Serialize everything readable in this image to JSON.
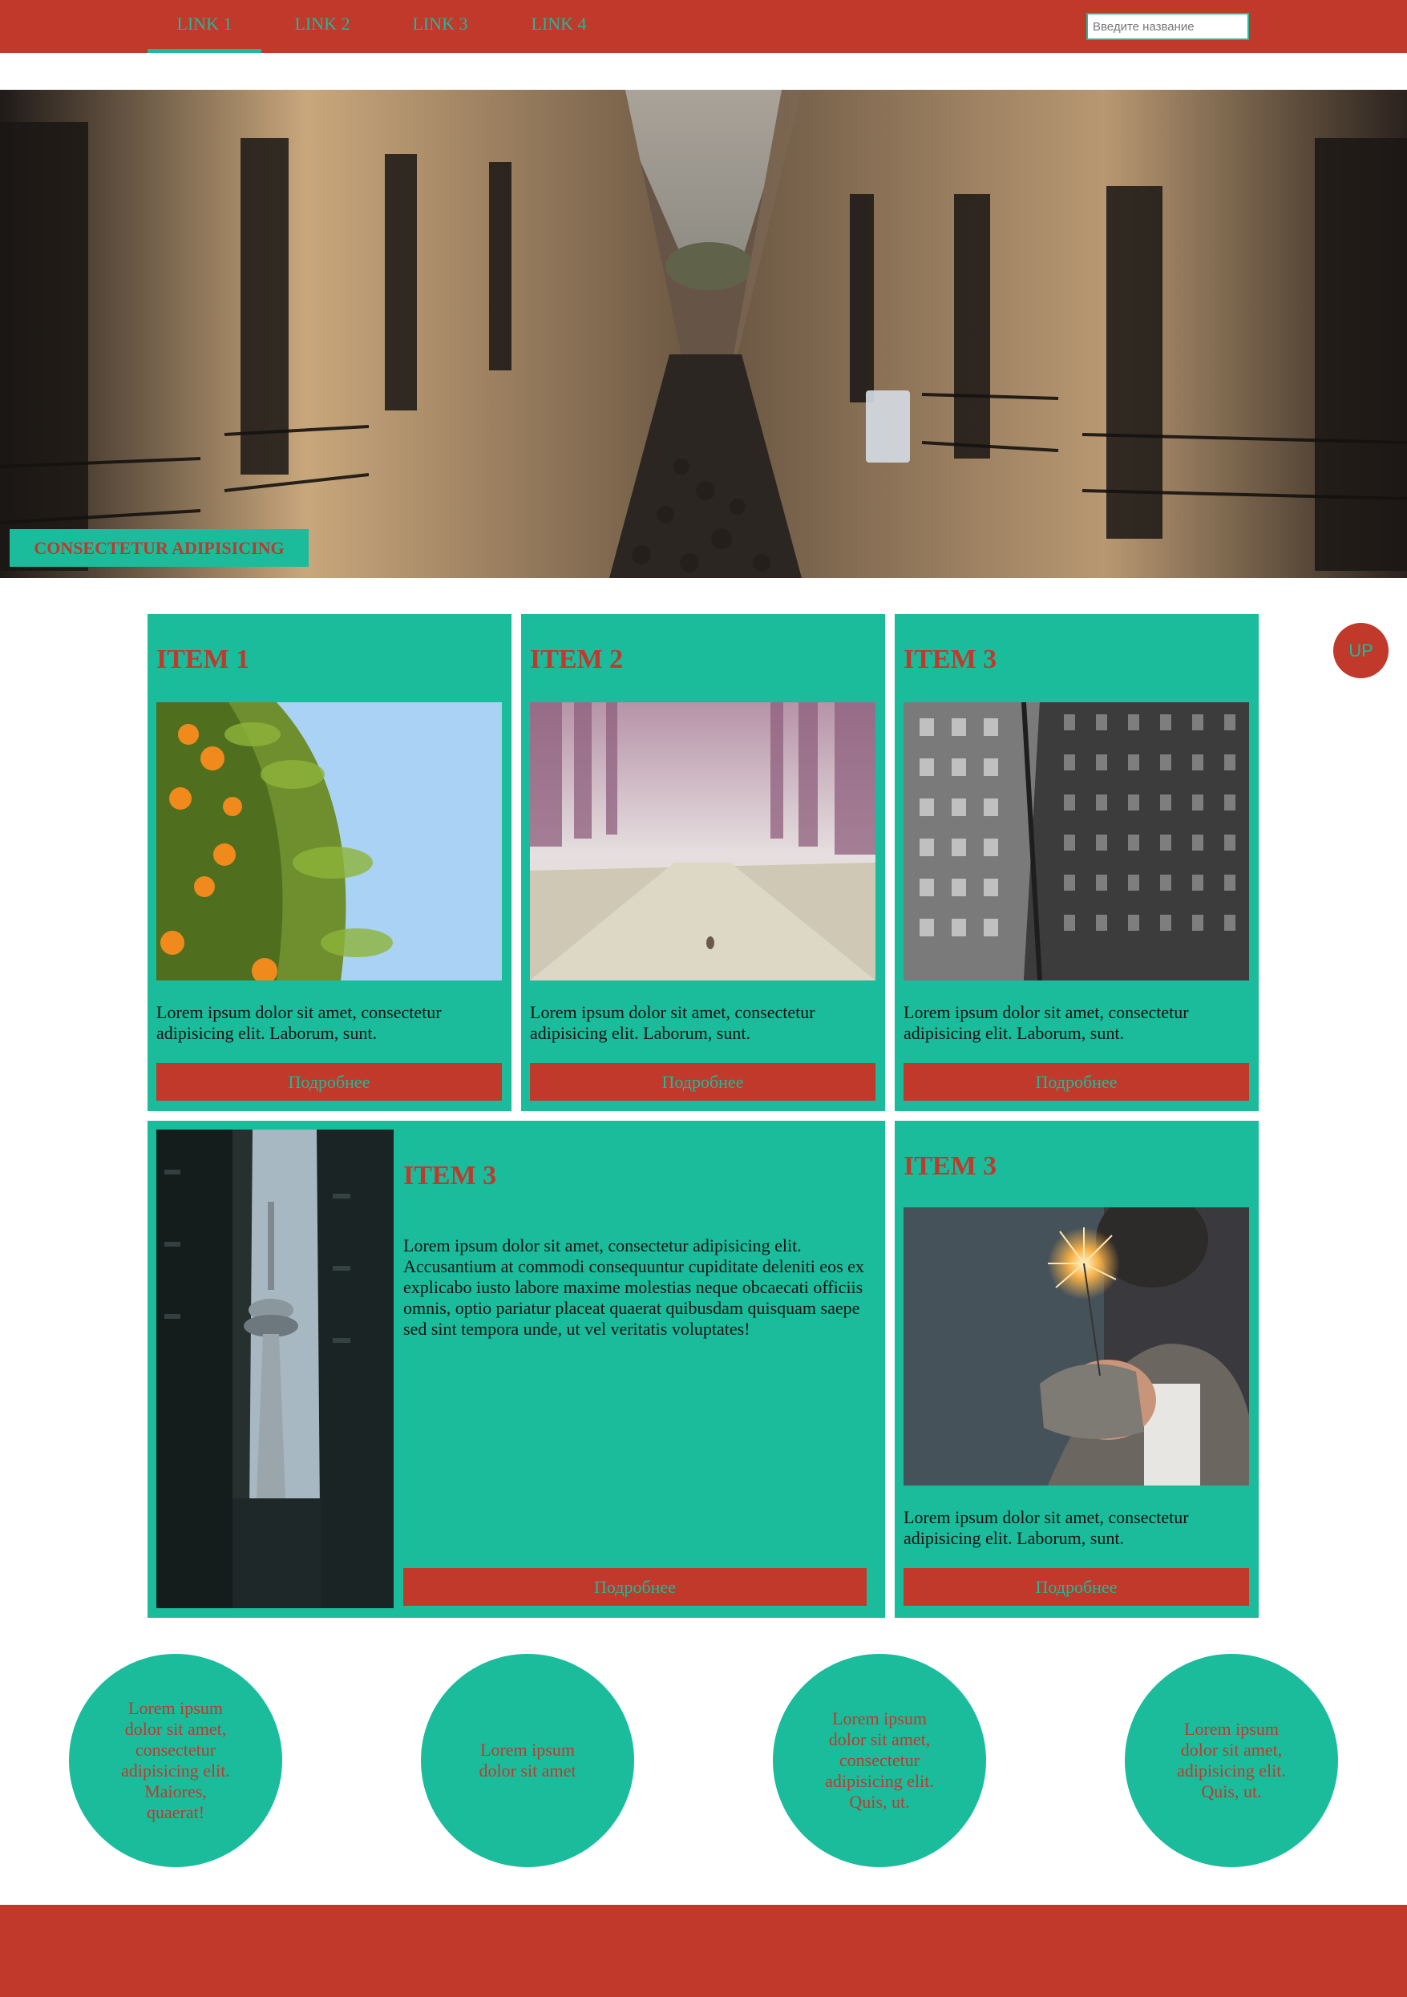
{
  "nav": {
    "links": [
      "LINK 1",
      "LINK 2",
      "LINK 3",
      "LINK 4"
    ],
    "active_index": 0,
    "search_placeholder": "Введите название"
  },
  "hero": {
    "caption": "CONSECTETUR ADIPISICING"
  },
  "cards": [
    {
      "title": "ITEM 1",
      "text": "Lorem ipsum dolor sit amet, consectetur adipisicing elit. Laborum, sunt.",
      "button": "Подробнее",
      "image": "orange-tree-photo"
    },
    {
      "title": "ITEM 2",
      "text": "Lorem ipsum dolor sit amet, consectetur adipisicing elit. Laborum, sunt.",
      "button": "Подробнее",
      "image": "misty-road-photo"
    },
    {
      "title": "ITEM 3",
      "text": "Lorem ipsum dolor sit amet, consectetur adipisicing elit. Laborum, sunt.",
      "button": "Подробнее",
      "image": "building-facade-photo"
    }
  ],
  "wide_card": {
    "title": "ITEM 3",
    "text": "Lorem ipsum dolor sit amet, consectetur adipisicing elit. Accusantium at commodi consequuntur cupiditate deleniti eos ex explicabo iusto labore maxime molestias neque obcaecati officiis omnis, optio pariatur placeat quaerat quibusdam quisquam saepe sed sint tempora unde, ut vel veritatis voluptates!",
    "button": "Подробнее",
    "image": "tower-photo"
  },
  "side_card": {
    "title": "ITEM 3",
    "text": "Lorem ipsum dolor sit amet, consectetur adipisicing elit. Laborum, sunt.",
    "button": "Подробнее",
    "image": "sparkler-photo"
  },
  "up_button": "UP",
  "circles": [
    "Lorem ipsum dolor sit amet, consectetur adipisicing elit. Maiores, quaerat!",
    "Lorem ipsum dolor sit amet",
    "Lorem ipsum dolor sit amet, consectetur adipisicing elit. Quis, ut.",
    "Lorem ipsum dolor sit amet, adipisicing elit. Quis, ut."
  ],
  "colors": {
    "primary_red": "#c0392b",
    "accent_teal": "#1abc9c",
    "background": "#ffffff"
  }
}
